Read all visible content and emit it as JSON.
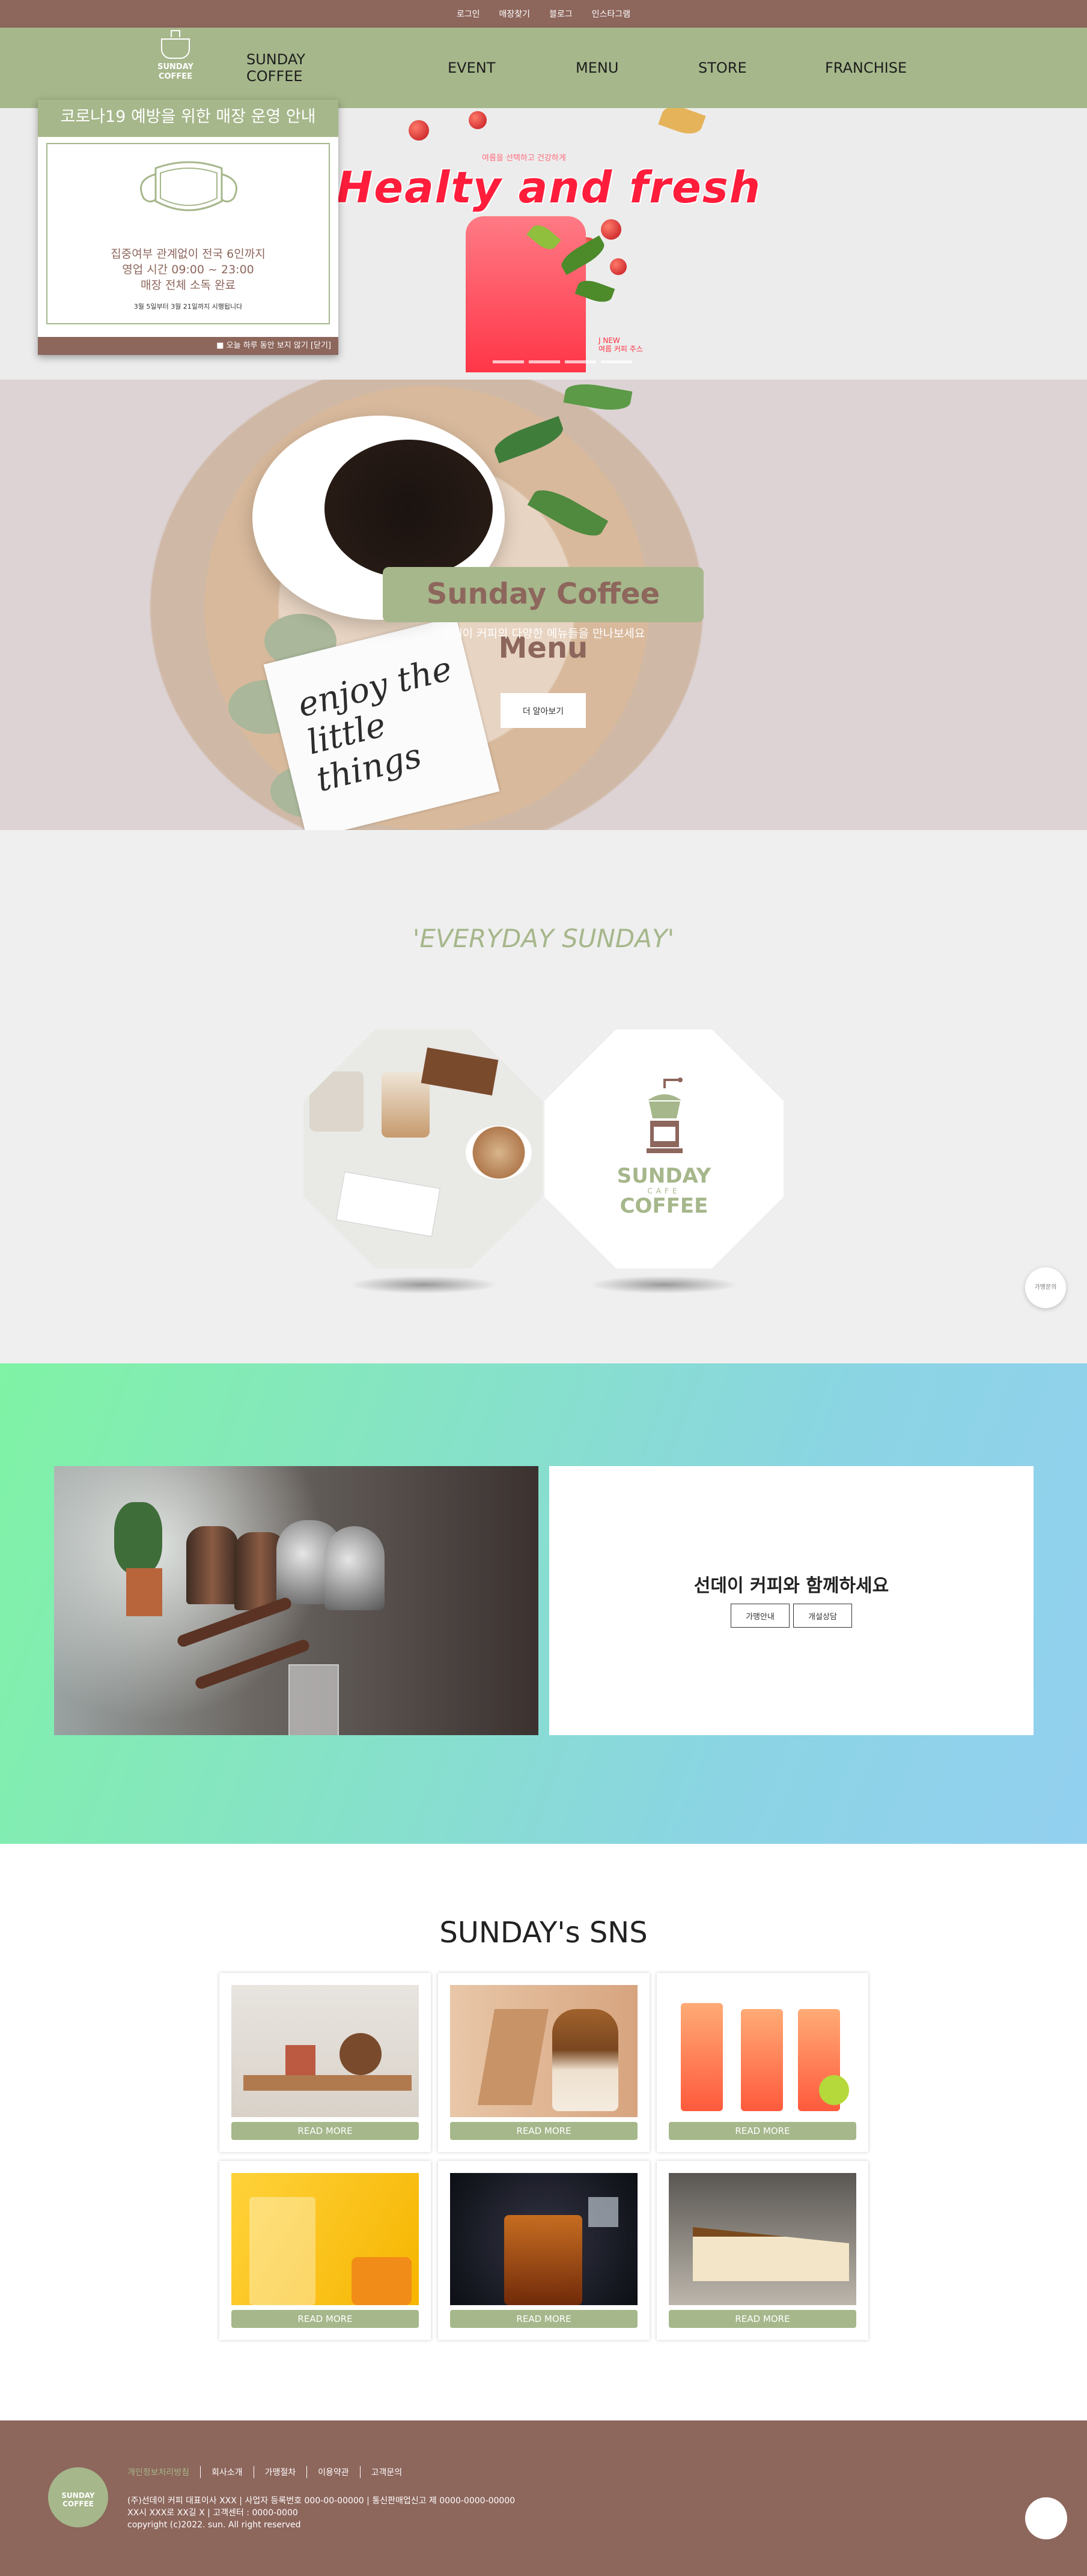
{
  "topbar": {
    "links": [
      "로그인",
      "매장찾기",
      "블로그",
      "인스타그램"
    ]
  },
  "nav": {
    "logo_line1": "SUNDAY",
    "logo_line2": "COFFEE",
    "menu": [
      "SUNDAY COFFEE",
      "EVENT",
      "MENU",
      "STORE",
      "FRANCHISE"
    ]
  },
  "hero": {
    "subtitle": "여름을 선택하고 건강하게",
    "title": "Healty and fresh",
    "new_tag_1": "J NEW",
    "new_tag_2": "여름 커피 주스",
    "slides": 4
  },
  "popup": {
    "title": "코로나19 예방을 위한 매장 운영 안내",
    "line1": "집중여부 관계없이 전국 6인까지",
    "line2": "영업 시간 09:00 ~ 23:00",
    "line3": "매장 전체 소독 완료",
    "date": "3월 5일부터 3월 21일까지 시행됩니다",
    "close_label": "■ 오늘 하루 동안 보지 않기 [닫기]"
  },
  "menu_banner": {
    "card_text": "enjoy the little things",
    "title": "Sunday Coffee Menu",
    "subtitle": "선데이 커피의 다양한 메뉴들을 만나보세요",
    "button": "더 알아보기"
  },
  "everyday": {
    "heading": "'EVERYDAY SUNDAY'",
    "brand_top": "SUNDAY",
    "brand_mid": "CAFE",
    "brand_bottom": "COFFEE",
    "side_button": "가맹문의"
  },
  "franchise": {
    "title": "선데이 커피와 함께하세요",
    "buttons": [
      "가맹안내",
      "개설상담"
    ]
  },
  "sns": {
    "heading": "SUNDAY's SNS",
    "cards": [
      {
        "image": "tea-tray-photo",
        "button": "READ MORE"
      },
      {
        "image": "dalgona-coffee-photo",
        "button": "READ MORE"
      },
      {
        "image": "strawberry-ade-photo",
        "button": "READ MORE"
      },
      {
        "image": "mango-juice-photo",
        "button": "READ MORE"
      },
      {
        "image": "iced-tea-splash-photo",
        "button": "READ MORE"
      },
      {
        "image": "cheesecake-photo",
        "button": "READ MORE"
      }
    ]
  },
  "footer": {
    "logo_line1": "SUNDAY",
    "logo_line2": "COFFEE",
    "links": [
      "개인정보처리방침",
      "회사소개",
      "가맹절차",
      "이용약관",
      "고객문의"
    ],
    "info_line1": "(주)선데이 커피 대표이사 XXX    |    사업자 등록번호 000-00-00000    |    통신판매업신고 제 0000-0000-00000",
    "info_line2": "XX시 XXX로 XX길 X    |    고객센터 : 0000-0000",
    "copyright": "copyright (c)2022. sun. All right reserved"
  },
  "colors": {
    "brown": "#8d665c",
    "green": "#a6b78b",
    "red": "#ff1d3b"
  }
}
